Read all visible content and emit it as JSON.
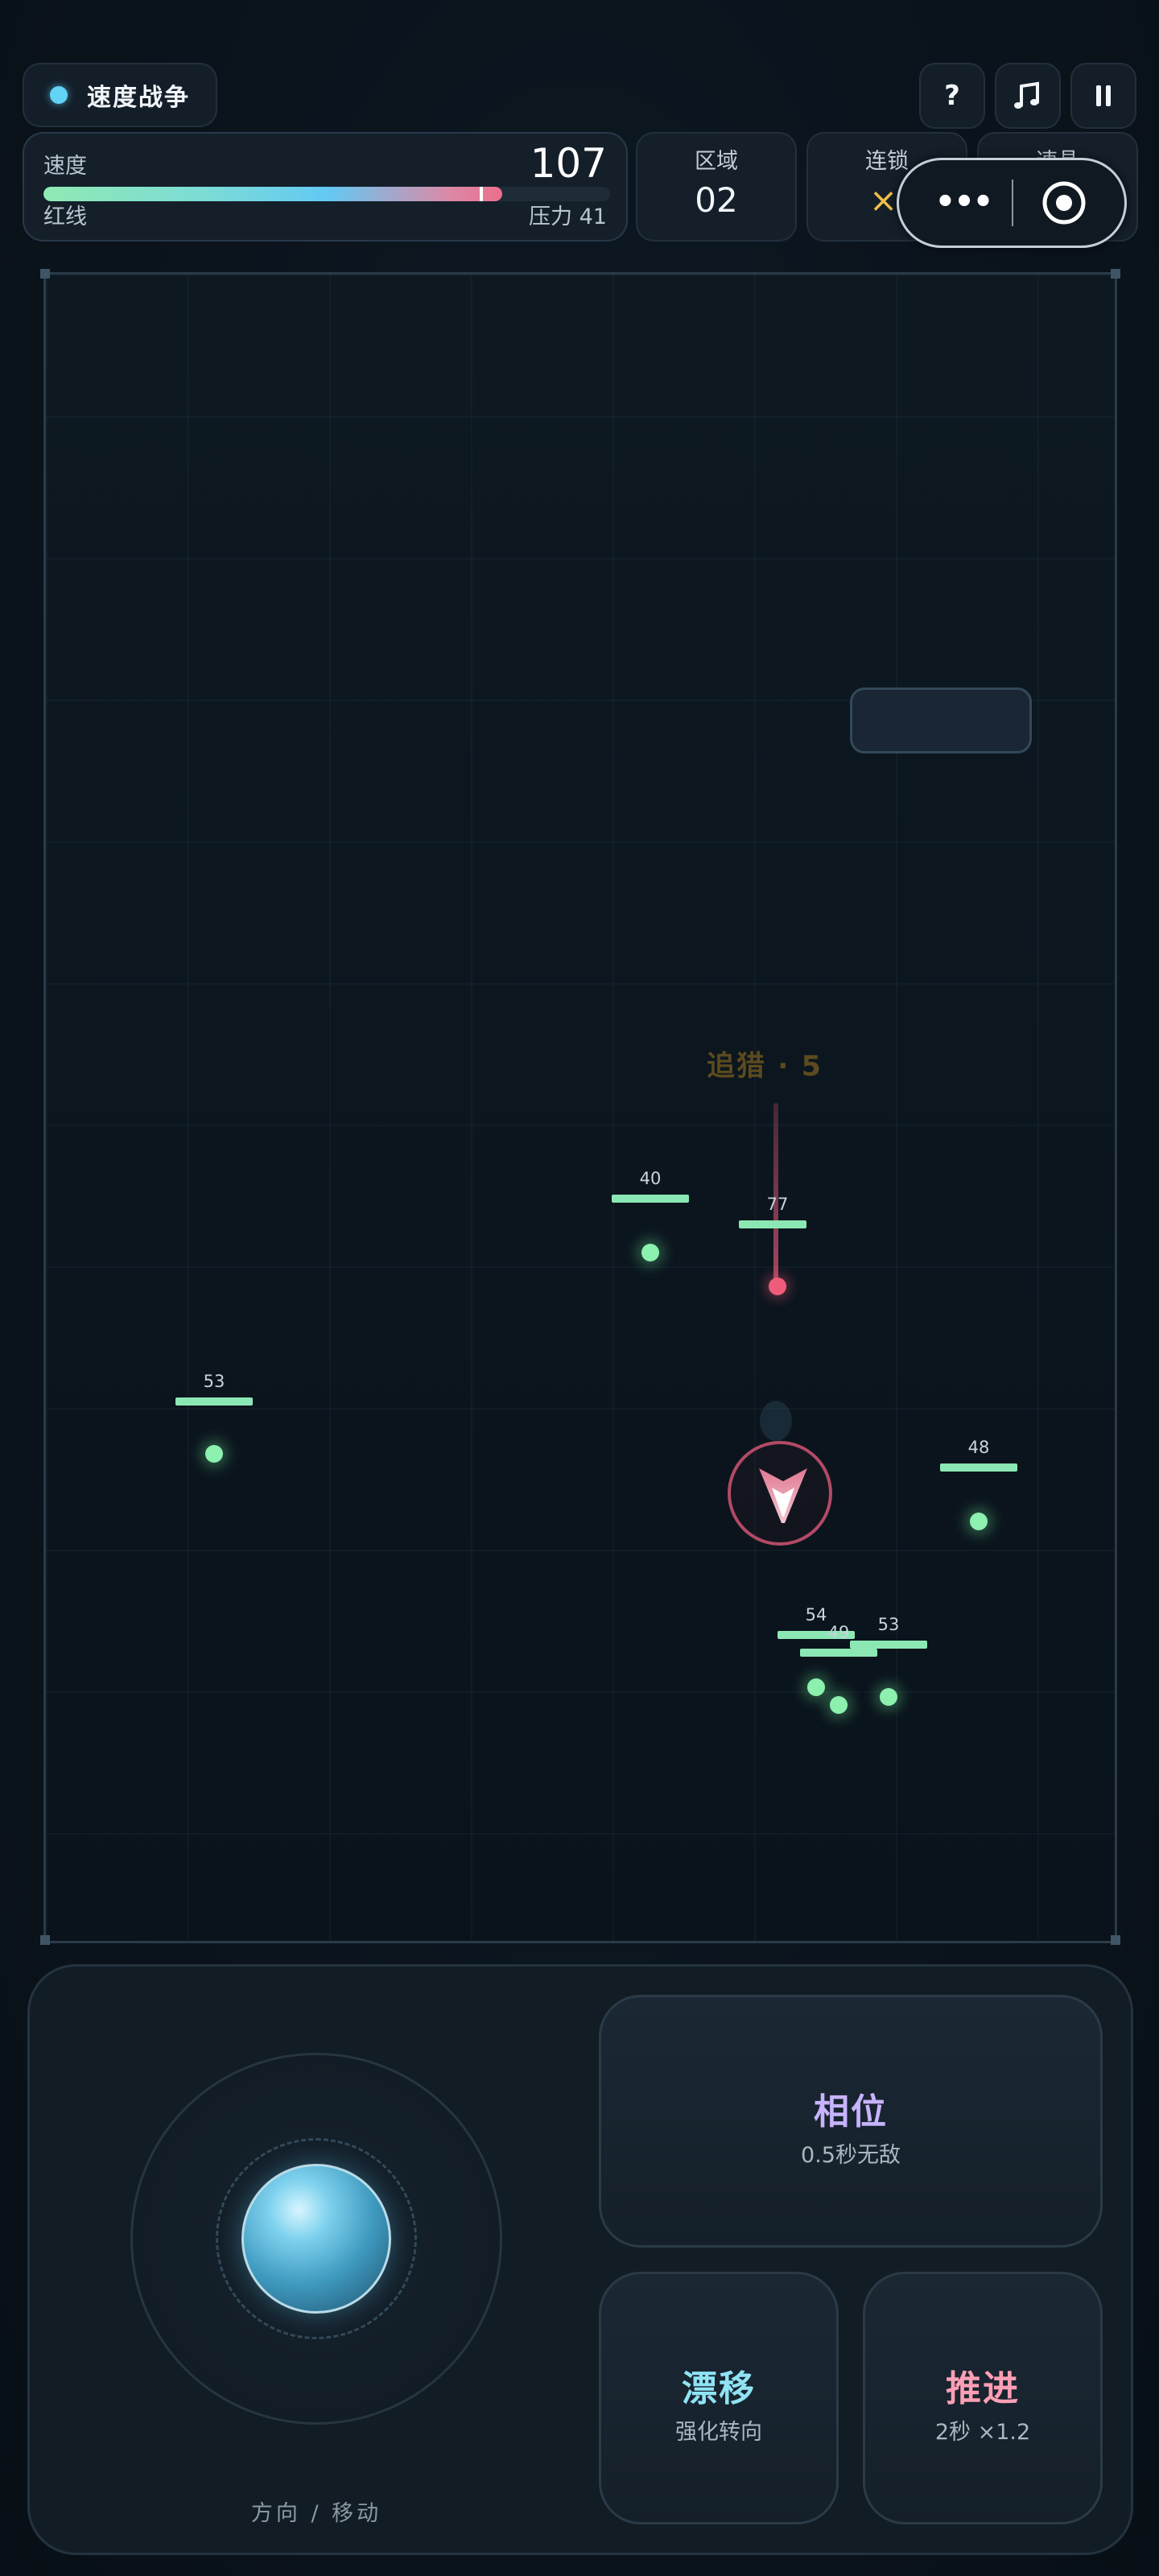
{
  "hud": {
    "title": "速度战争",
    "help_label": "?",
    "music_label": "♫",
    "pause_label": "⏸",
    "speed": {
      "label": "速度",
      "value": "107",
      "redline_label": "红线",
      "pressure_text": "压力 41",
      "fill_fraction": 0.81,
      "marker_fraction": 0.77
    },
    "stats": [
      {
        "label": "区域",
        "value": "02"
      },
      {
        "label": "连锁",
        "value": "×5"
      },
      {
        "label": "速晶",
        "value": ""
      }
    ],
    "capsule": {
      "more_label": "•••"
    }
  },
  "arena": {
    "floating_text": "追猎 · 5",
    "enemies": [
      {
        "hp": "40"
      },
      {
        "hp": "77"
      },
      {
        "hp": "53"
      },
      {
        "hp": "48"
      },
      {
        "hp": "54"
      },
      {
        "hp": "49"
      },
      {
        "hp": "53"
      }
    ]
  },
  "controls": {
    "joystick_caption": "方向 / 移动",
    "skills": [
      {
        "name": "相位",
        "desc": "0.5秒无敌",
        "color": "#c8b3ff"
      },
      {
        "name": "漂移",
        "desc": "强化转向",
        "color": "#8fe3f5"
      },
      {
        "name": "推进",
        "desc": "2秒 ×1.2",
        "color": "#ff9fb5"
      }
    ]
  },
  "colors": {
    "accent_cyan": "#62d2f5",
    "enemy_green": "#8be8b4",
    "danger_pink": "#ec6f8c",
    "chain_gold": "#f2c04a"
  }
}
